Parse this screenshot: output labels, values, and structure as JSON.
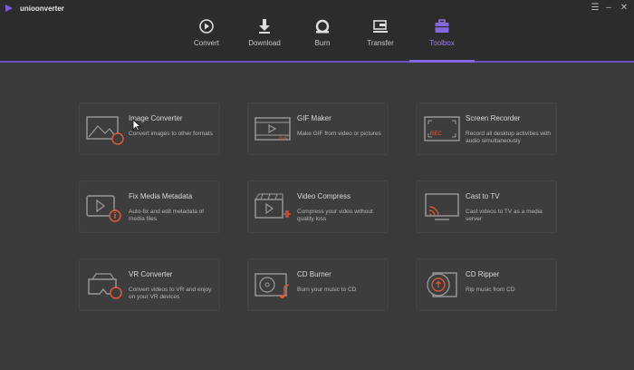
{
  "app": {
    "title": "unioonverter"
  },
  "colors": {
    "accent": "#8466e0",
    "icon_line": "#9a9a9a",
    "icon_highlight": "#e8593b"
  },
  "nav": {
    "tabs": [
      {
        "label": "Convert",
        "icon": "convert-icon"
      },
      {
        "label": "Download",
        "icon": "download-icon"
      },
      {
        "label": "Burn",
        "icon": "burn-icon"
      },
      {
        "label": "Transfer",
        "icon": "transfer-icon"
      },
      {
        "label": "Toolbox",
        "icon": "toolbox-icon",
        "active": true
      }
    ]
  },
  "tools": [
    {
      "title": "Image Converter",
      "desc": "Convert images to other formats",
      "icon": "image-converter-icon"
    },
    {
      "title": "GIF Maker",
      "desc": "Make GIF from video or pictures",
      "icon": "gif-maker-icon",
      "badge": "GIF"
    },
    {
      "title": "Screen Recorder",
      "desc": "Record all desktop activities with audio simultaneously",
      "icon": "screen-recorder-icon",
      "badge": "REC"
    },
    {
      "title": "Fix Media Metadata",
      "desc": "Auto-fix and edit metadata of media files",
      "icon": "metadata-icon"
    },
    {
      "title": "Video Compress",
      "desc": "Compress your video without quality loss",
      "icon": "video-compress-icon"
    },
    {
      "title": "Cast to TV",
      "desc": "Cast videos to TV as a media server",
      "icon": "cast-tv-icon"
    },
    {
      "title": "VR Converter",
      "desc": "Convert videos to VR and enjoy on your VR devices",
      "icon": "vr-converter-icon"
    },
    {
      "title": "CD Burner",
      "desc": "Burn your music to CD",
      "icon": "cd-burner-icon"
    },
    {
      "title": "CD Ripper",
      "desc": "Rip music from CD",
      "icon": "cd-ripper-icon"
    }
  ]
}
